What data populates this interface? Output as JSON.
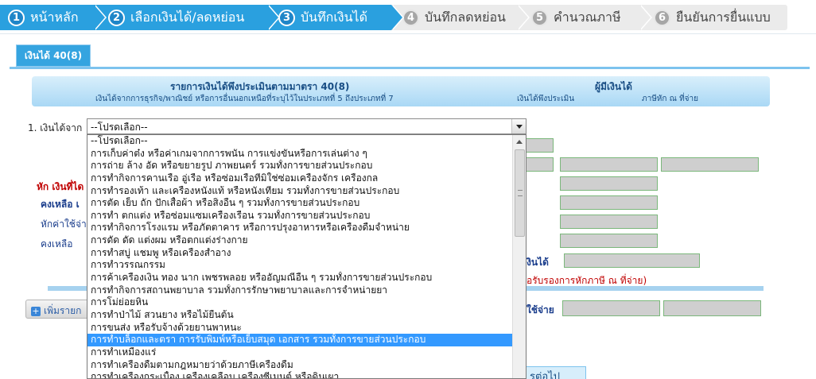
{
  "steps": [
    {
      "num": "1",
      "label": "หน้าหลัก",
      "state": "active"
    },
    {
      "num": "2",
      "label": "เลือกเงินได้/ลดหย่อน",
      "state": "active"
    },
    {
      "num": "3",
      "label": "บันทึกเงินได้",
      "state": "active"
    },
    {
      "num": "4",
      "label": "บันทึกลดหย่อน",
      "state": "inactive"
    },
    {
      "num": "5",
      "label": "คำนวณภาษี",
      "state": "inactive"
    },
    {
      "num": "6",
      "label": "ยืนยันการยื่นแบบ",
      "state": "inactive"
    }
  ],
  "tab": {
    "label": "เงินได้ 40(8)"
  },
  "header": {
    "title": "รายการเงินได้พึงประเมินตามมาตรา 40(8)",
    "subtitle": "เงินได้จากการธุรกิจ/พาณิชย์ หรือการอื่นนอกเหนือที่ระบุไว้ในประเภทที่ 5 ถึงประเภทที่ 7",
    "payer_title": "ผู้มีเงินได้",
    "col_income": "เงินได้พึงประเมิน",
    "col_withheld": "ภาษีหัก ณ ที่จ่าย"
  },
  "form": {
    "income_from_label": "1. เงินได้จาก",
    "select_value": "--โปรดเลือก--",
    "bg_labels": {
      "deduct": "หัก เงินที่ได",
      "remain": "คงเหลือ เ",
      "expense": "หักค่าใช้จ่า",
      "remain2": "คงเหลือ",
      "income_right": "งินได้",
      "cert_note": "อรับรองการหักภาษี ณ ที่จ่าย)",
      "expense_right": "ใช้จ่าย"
    },
    "add_button": "เพิ่มรายก",
    "next_button": "รต่อไป"
  },
  "dropdown": {
    "selected_index": 16,
    "options": [
      "--โปรดเลือก--",
      "การเก็บค่าต๋ง หรือค่าเกมจากการพนัน การแข่งขันหรือการเล่นต่าง ๆ",
      "การถ่าย ล้าง อัด หรือขยายรูป ภาพยนตร์ รวมทั้งการขายส่วนประกอบ",
      "การทำกิจการคานเรือ อู่เรือ หรือซ่อมเรือที่มิใช่ซ่อมเครื่องจักร เครื่องกล",
      "การทำรองเท้า และเครื่องหนังแท้ หรือหนังเทียม รวมทั้งการขายส่วนประกอบ",
      "การตัด เย็บ ถัก ปักเสื้อผ้า หรือสิ่งอื่น ๆ รวมทั้งการขายส่วนประกอบ",
      "การทำ ตกแต่ง หรือซ่อมแซมเครื่องเรือน รวมทั้งการขายส่วนประกอบ",
      "การทำกิจการโรงแรม หรือภัตตาคาร หรือการปรุงอาหารหรือเครื่องดื่มจำหน่าย",
      "การดัด ดัด แต่งผม หรือตกแต่งร่างกาย",
      "การทำสบู่ แชมพู หรือเครื่องสำอาง",
      "การทำวรรณกรรม",
      "การค้าเครื่องเงิน ทอง นาก เพชรพลอย หรืออัญมณีอื่น ๆ รวมทั้งการขายส่วนประกอบ",
      "การทำกิจการสถานพยาบาล รวมทั้งการรักษาพยาบาลและการจำหน่ายยา",
      "การโม่ย่อยหิน",
      "การทำป่าไม้ สวนยาง หรือไม้ยืนต้น",
      "การขนส่ง หรือรับจ้างด้วยยานพาหนะ",
      "การทำบล็อกและตรา การรับพิมพ์หรือเย็บสมุด เอกสาร รวมทั้งการขายส่วนประกอบ",
      "การทำเหมืองแร่",
      "การทำเครื่องดื่มตามกฎหมายว่าด้วยภาษีเครื่องดื่ม",
      "การทำเครื่องกระเบื้อง เครื่องเคลือบ เครื่องซีเมนต์ หรือดินเผา"
    ]
  },
  "colors": {
    "accent": "#2aa0df",
    "selected": "#3399ff",
    "field_bg": "#cfcfcf",
    "field_border": "#7bb77b",
    "label_red": "#c00000",
    "label_navy": "#1a3d8c"
  }
}
